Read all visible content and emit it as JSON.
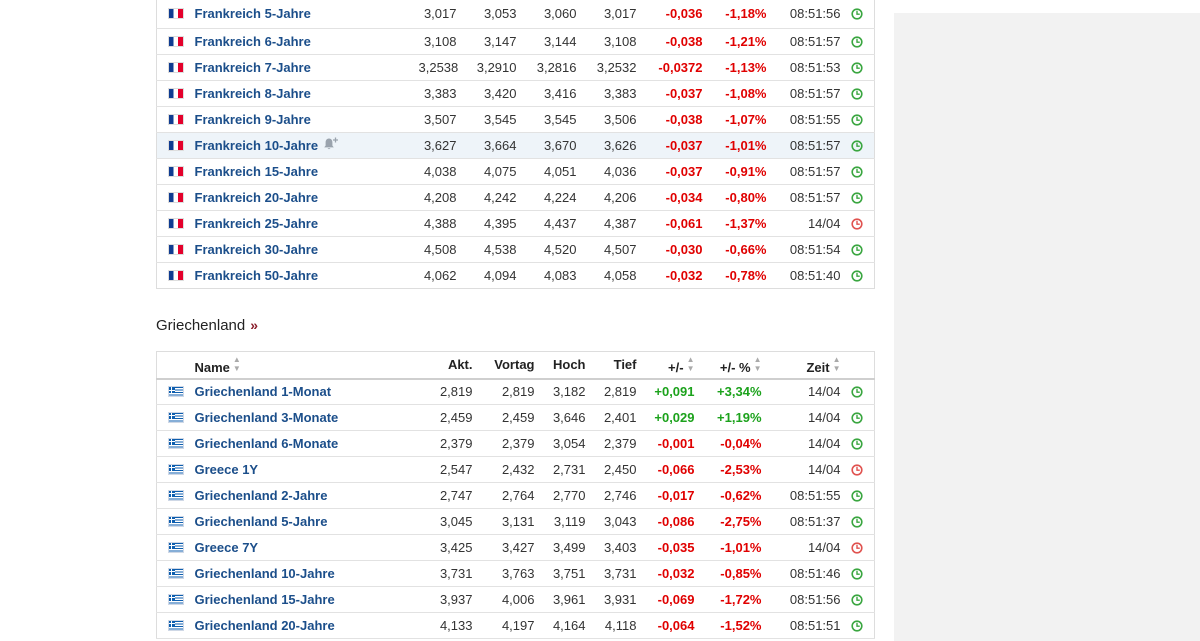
{
  "france": {
    "rows": [
      {
        "name": "Frankreich 5-Jahre",
        "akt": "3,017",
        "vortag": "3,053",
        "hoch": "3,060",
        "tief": "3,017",
        "change": "-0,036",
        "change_pct": "-1,18%",
        "time": "08:51:56",
        "status": "live"
      },
      {
        "name": "Frankreich 6-Jahre",
        "akt": "3,108",
        "vortag": "3,147",
        "hoch": "3,144",
        "tief": "3,108",
        "change": "-0,038",
        "change_pct": "-1,21%",
        "time": "08:51:57",
        "status": "live"
      },
      {
        "name": "Frankreich 7-Jahre",
        "akt": "3,2538",
        "vortag": "3,2910",
        "hoch": "3,2816",
        "tief": "3,2532",
        "change": "-0,0372",
        "change_pct": "-1,13%",
        "time": "08:51:53",
        "status": "live"
      },
      {
        "name": "Frankreich 8-Jahre",
        "akt": "3,383",
        "vortag": "3,420",
        "hoch": "3,416",
        "tief": "3,383",
        "change": "-0,037",
        "change_pct": "-1,08%",
        "time": "08:51:57",
        "status": "live"
      },
      {
        "name": "Frankreich 9-Jahre",
        "akt": "3,507",
        "vortag": "3,545",
        "hoch": "3,545",
        "tief": "3,506",
        "change": "-0,038",
        "change_pct": "-1,07%",
        "time": "08:51:55",
        "status": "live"
      },
      {
        "name": "Frankreich 10-Jahre",
        "akt": "3,627",
        "vortag": "3,664",
        "hoch": "3,670",
        "tief": "3,626",
        "change": "-0,037",
        "change_pct": "-1,01%",
        "time": "08:51:57",
        "status": "live",
        "highlight": true,
        "bell": true
      },
      {
        "name": "Frankreich 15-Jahre",
        "akt": "4,038",
        "vortag": "4,075",
        "hoch": "4,051",
        "tief": "4,036",
        "change": "-0,037",
        "change_pct": "-0,91%",
        "time": "08:51:57",
        "status": "live"
      },
      {
        "name": "Frankreich 20-Jahre",
        "akt": "4,208",
        "vortag": "4,242",
        "hoch": "4,224",
        "tief": "4,206",
        "change": "-0,034",
        "change_pct": "-0,80%",
        "time": "08:51:57",
        "status": "live"
      },
      {
        "name": "Frankreich 25-Jahre",
        "akt": "4,388",
        "vortag": "4,395",
        "hoch": "4,437",
        "tief": "4,387",
        "change": "-0,061",
        "change_pct": "-1,37%",
        "time": "14/04",
        "status": "closed"
      },
      {
        "name": "Frankreich 30-Jahre",
        "akt": "4,508",
        "vortag": "4,538",
        "hoch": "4,520",
        "tief": "4,507",
        "change": "-0,030",
        "change_pct": "-0,66%",
        "time": "08:51:54",
        "status": "live"
      },
      {
        "name": "Frankreich 50-Jahre",
        "akt": "4,062",
        "vortag": "4,094",
        "hoch": "4,083",
        "tief": "4,058",
        "change": "-0,032",
        "change_pct": "-0,78%",
        "time": "08:51:40",
        "status": "live"
      }
    ]
  },
  "greece": {
    "title": "Griechenland",
    "title_link": "»",
    "headers": {
      "name": "Name",
      "akt": "Akt.",
      "vortag": "Vortag",
      "hoch": "Hoch",
      "tief": "Tief",
      "change": "+/-",
      "change_pct": "+/- %",
      "time": "Zeit"
    },
    "rows": [
      {
        "name": "Griechenland 1-Monat",
        "akt": "2,819",
        "vortag": "2,819",
        "hoch": "3,182",
        "tief": "2,819",
        "change": "+0,091",
        "change_pct": "+3,34%",
        "time": "14/04",
        "status": "live"
      },
      {
        "name": "Griechenland 3-Monate",
        "akt": "2,459",
        "vortag": "2,459",
        "hoch": "3,646",
        "tief": "2,401",
        "change": "+0,029",
        "change_pct": "+1,19%",
        "time": "14/04",
        "status": "live"
      },
      {
        "name": "Griechenland 6-Monate",
        "akt": "2,379",
        "vortag": "2,379",
        "hoch": "3,054",
        "tief": "2,379",
        "change": "-0,001",
        "change_pct": "-0,04%",
        "time": "14/04",
        "status": "live"
      },
      {
        "name": "Greece 1Y",
        "akt": "2,547",
        "vortag": "2,432",
        "hoch": "2,731",
        "tief": "2,450",
        "change": "-0,066",
        "change_pct": "-2,53%",
        "time": "14/04",
        "status": "closed"
      },
      {
        "name": "Griechenland 2-Jahre",
        "akt": "2,747",
        "vortag": "2,764",
        "hoch": "2,770",
        "tief": "2,746",
        "change": "-0,017",
        "change_pct": "-0,62%",
        "time": "08:51:55",
        "status": "live"
      },
      {
        "name": "Griechenland 5-Jahre",
        "akt": "3,045",
        "vortag": "3,131",
        "hoch": "3,119",
        "tief": "3,043",
        "change": "-0,086",
        "change_pct": "-2,75%",
        "time": "08:51:37",
        "status": "live"
      },
      {
        "name": "Greece 7Y",
        "akt": "3,425",
        "vortag": "3,427",
        "hoch": "3,499",
        "tief": "3,403",
        "change": "-0,035",
        "change_pct": "-1,01%",
        "time": "14/04",
        "status": "closed"
      },
      {
        "name": "Griechenland 10-Jahre",
        "akt": "3,731",
        "vortag": "3,763",
        "hoch": "3,751",
        "tief": "3,731",
        "change": "-0,032",
        "change_pct": "-0,85%",
        "time": "08:51:46",
        "status": "live"
      },
      {
        "name": "Griechenland 15-Jahre",
        "akt": "3,937",
        "vortag": "4,006",
        "hoch": "3,961",
        "tief": "3,931",
        "change": "-0,069",
        "change_pct": "-1,72%",
        "time": "08:51:56",
        "status": "live"
      },
      {
        "name": "Griechenland 20-Jahre",
        "akt": "4,133",
        "vortag": "4,197",
        "hoch": "4,164",
        "tief": "4,118",
        "change": "-0,064",
        "change_pct": "-1,52%",
        "time": "08:51:51",
        "status": "live"
      }
    ]
  },
  "colors": {
    "link": "#1b4e8a",
    "negative": "#e00000",
    "positive": "#1ca21c",
    "status_live": "#3aa640",
    "status_closed": "#e0524f",
    "highlight_row": "#eef4f9"
  },
  "icons": {
    "flag_fr": "france-flag-icon",
    "flag_gr": "greece-flag-icon",
    "status_live": "clock-green-icon",
    "status_closed": "clock-red-icon",
    "alert": "bell-plus-icon",
    "sort": "sort-icon"
  }
}
